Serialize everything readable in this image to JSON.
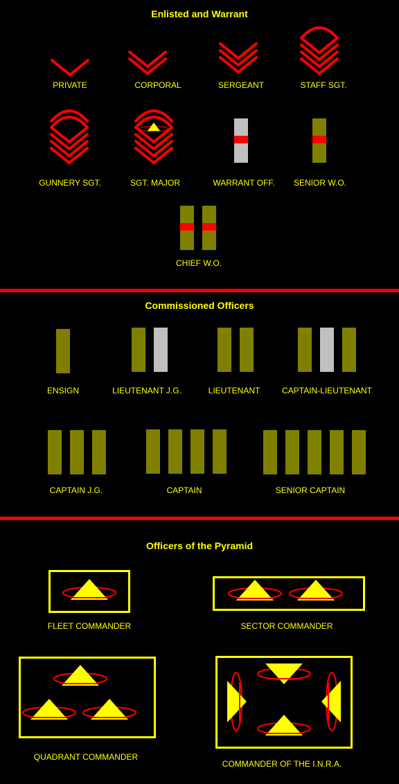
{
  "colors": {
    "background": "#000000",
    "text": "#ffff00",
    "red": "#ff0000",
    "olive": "#808000",
    "silver": "#c0c0c0",
    "yellow": "#ffff00"
  },
  "sections": [
    {
      "title": "Enlisted and Warrant",
      "ranks": [
        {
          "label": "PRIVATE",
          "insignia": {
            "kind": "chevrons",
            "count": 1,
            "arcs": 0
          }
        },
        {
          "label": "CORPORAL",
          "insignia": {
            "kind": "chevrons",
            "count": 2,
            "arcs": 0
          }
        },
        {
          "label": "SERGEANT",
          "insignia": {
            "kind": "chevrons",
            "count": 3,
            "arcs": 0
          }
        },
        {
          "label": "STAFF SGT.",
          "insignia": {
            "kind": "chevrons",
            "count": 3,
            "arcs": 1
          }
        },
        {
          "label": "GUNNERY SGT.",
          "insignia": {
            "kind": "chevrons",
            "count": 3,
            "arcs": 2
          }
        },
        {
          "label": "SGT. MAJOR",
          "insignia": {
            "kind": "chevrons",
            "count": 3,
            "arcs": 2,
            "pyramid": true
          }
        },
        {
          "label": "WARRANT OFF.",
          "insignia": {
            "kind": "bars",
            "bars": [
              "silver"
            ],
            "stripe": true
          }
        },
        {
          "label": "SENIOR  W.O.",
          "insignia": {
            "kind": "bars",
            "bars": [
              "olive"
            ],
            "stripe": true
          }
        },
        {
          "label": "CHIEF W.O.",
          "insignia": {
            "kind": "bars",
            "bars": [
              "olive",
              "olive"
            ],
            "stripe": true
          }
        }
      ]
    },
    {
      "title": "Commissioned Officers",
      "ranks": [
        {
          "label": "ENSIGN",
          "insignia": {
            "kind": "bars",
            "bars": [
              "olive"
            ]
          }
        },
        {
          "label": "LIEUTENANT J.G.",
          "insignia": {
            "kind": "bars",
            "bars": [
              "olive",
              "silver"
            ]
          }
        },
        {
          "label": "LIEUTENANT",
          "insignia": {
            "kind": "bars",
            "bars": [
              "olive",
              "olive"
            ]
          }
        },
        {
          "label": "CAPTAIN-LIEUTENANT",
          "insignia": {
            "kind": "bars",
            "bars": [
              "olive",
              "silver",
              "olive"
            ]
          }
        },
        {
          "label": "CAPTAIN J.G.",
          "insignia": {
            "kind": "bars",
            "bars": [
              "olive",
              "olive",
              "olive"
            ]
          }
        },
        {
          "label": "CAPTAIN",
          "insignia": {
            "kind": "bars",
            "bars": [
              "olive",
              "olive",
              "olive",
              "olive"
            ]
          }
        },
        {
          "label": "SENIOR CAPTAIN",
          "insignia": {
            "kind": "bars",
            "bars": [
              "olive",
              "olive",
              "olive",
              "olive",
              "olive"
            ]
          }
        }
      ]
    },
    {
      "title": "Officers of the Pyramid",
      "ranks": [
        {
          "label": "FLEET COMMANDER",
          "insignia": {
            "kind": "pyramids",
            "count": 1,
            "arrangement": "single"
          }
        },
        {
          "label": "SECTOR COMMANDER",
          "insignia": {
            "kind": "pyramids",
            "count": 2,
            "arrangement": "row"
          }
        },
        {
          "label": "QUADRANT COMMANDER",
          "insignia": {
            "kind": "pyramids",
            "count": 3,
            "arrangement": "triangle"
          }
        },
        {
          "label": "COMMANDER OF THE I.N.R.A.",
          "insignia": {
            "kind": "pyramids",
            "count": 4,
            "arrangement": "cross-inward"
          }
        }
      ]
    }
  ]
}
